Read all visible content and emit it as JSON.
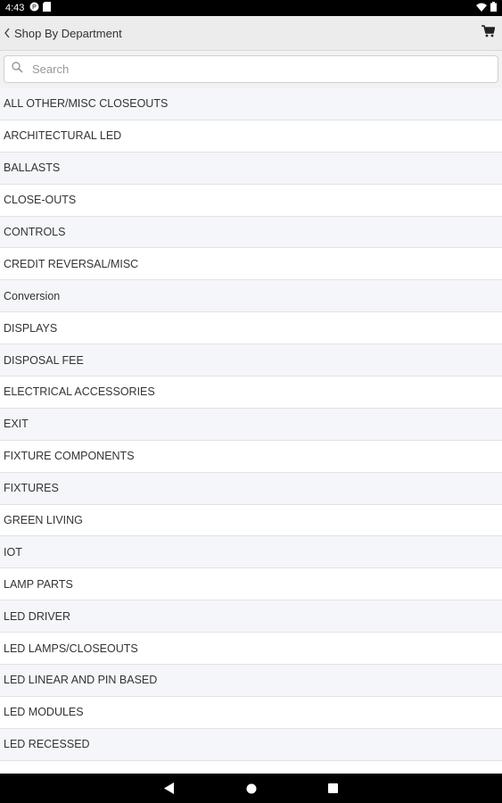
{
  "status_bar": {
    "time": "4:43"
  },
  "header": {
    "back_label": "Shop By Department"
  },
  "search": {
    "placeholder": "Search",
    "value": ""
  },
  "departments": [
    "ALL OTHER/MISC CLOSEOUTS",
    "ARCHITECTURAL LED",
    "BALLASTS",
    "CLOSE-OUTS",
    "CONTROLS",
    "CREDIT REVERSAL/MISC",
    "Conversion",
    "DISPLAYS",
    "DISPOSAL FEE",
    "ELECTRICAL ACCESSORIES",
    "EXIT",
    "FIXTURE COMPONENTS",
    "FIXTURES",
    "GREEN LIVING",
    "IOT",
    "LAMP PARTS",
    "LED DRIVER",
    "LED LAMPS/CLOSEOUTS",
    "LED LINEAR AND PIN BASED",
    "LED MODULES",
    "LED RECESSED"
  ],
  "icons": {
    "back": "chevron-left-icon",
    "cart": "cart-icon",
    "search": "search-icon"
  }
}
